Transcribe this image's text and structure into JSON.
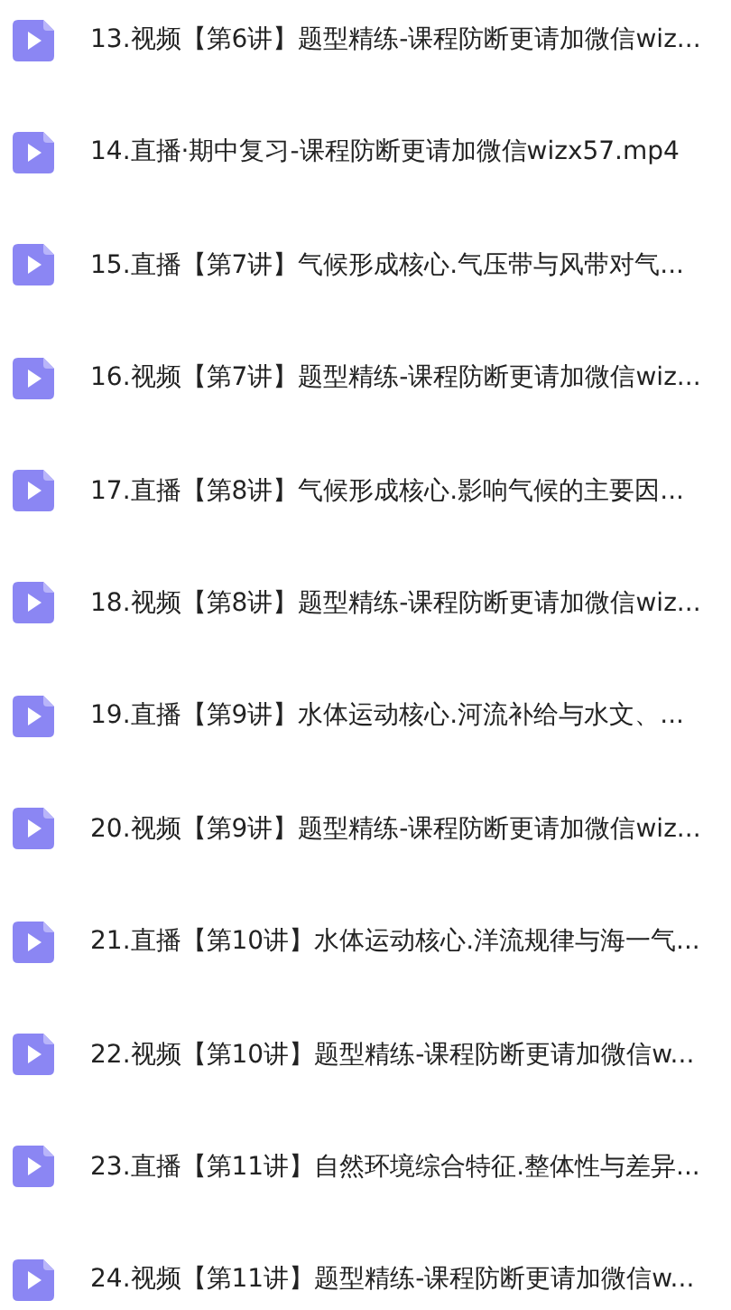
{
  "files": [
    {
      "name": "13.视频【第6讲】题型精练-课程防断更请加微信wiz..."
    },
    {
      "name": "14.直播·期中复习-课程防断更请加微信wizx57.mp4"
    },
    {
      "name": "15.直播【第7讲】气候形成核心.气压带与风带对气..."
    },
    {
      "name": "16.视频【第7讲】题型精练-课程防断更请加微信wiz..."
    },
    {
      "name": "17.直播【第8讲】气候形成核心.影响气候的主要因..."
    },
    {
      "name": "18.视频【第8讲】题型精练-课程防断更请加微信wiz..."
    },
    {
      "name": "19.直播【第9讲】水体运动核心.河流补给与水文、..."
    },
    {
      "name": "20.视频【第9讲】题型精练-课程防断更请加微信wiz..."
    },
    {
      "name": "21.直播【第10讲】水体运动核心.洋流规律与海一气..."
    },
    {
      "name": "22.视频【第10讲】题型精练-课程防断更请加微信w..."
    },
    {
      "name": "23.直播【第11讲】自然环境综合特征.整体性与差异..."
    },
    {
      "name": "24.视频【第11讲】题型精练-课程防断更请加微信w..."
    }
  ]
}
